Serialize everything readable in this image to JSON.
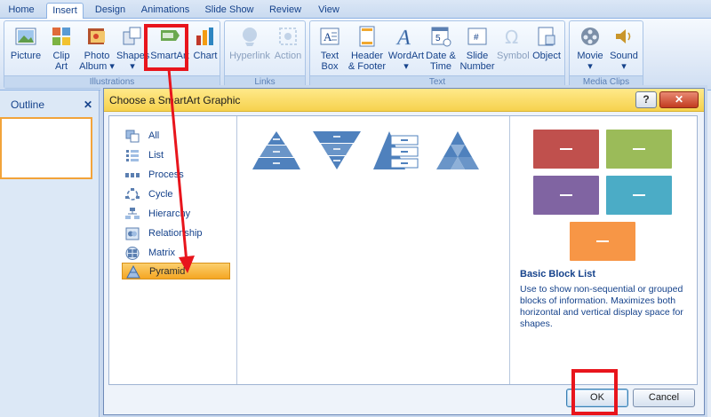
{
  "ribbon": {
    "tabs": [
      "Home",
      "Insert",
      "Design",
      "Animations",
      "Slide Show",
      "Review",
      "View"
    ],
    "active_tab": "Insert",
    "groups": {
      "illustrations": "Illustrations",
      "links": "Links",
      "text": "Text",
      "media": "Media Clips"
    },
    "buttons": {
      "picture": [
        "Picture"
      ],
      "clip_art": [
        "Clip",
        "Art"
      ],
      "photo_album": [
        "Photo",
        "Album ▾"
      ],
      "shapes": [
        "Shapes",
        "▾"
      ],
      "smartart": [
        "SmartArt"
      ],
      "chart": [
        "Chart"
      ],
      "hyperlink": [
        "Hyperlink"
      ],
      "action": [
        "Action"
      ],
      "text_box": [
        "Text",
        "Box"
      ],
      "header_footer": [
        "Header",
        "& Footer"
      ],
      "wordart": [
        "WordArt",
        "▾"
      ],
      "date_time": [
        "Date &",
        "Time"
      ],
      "slide_number": [
        "Slide",
        "Number"
      ],
      "symbol": [
        "Symbol"
      ],
      "object": [
        "Object"
      ],
      "movie": [
        "Movie",
        "▾"
      ],
      "sound": [
        "Sound",
        "▾"
      ]
    }
  },
  "pane": {
    "outline_tab": "Outline",
    "close_glyph": "✕"
  },
  "dialog": {
    "title": "Choose a SmartArt Graphic",
    "help_glyph": "?",
    "close_glyph": "✕",
    "categories": [
      {
        "label": "All",
        "icon": "all-icon"
      },
      {
        "label": "List",
        "icon": "list-icon"
      },
      {
        "label": "Process",
        "icon": "process-icon"
      },
      {
        "label": "Cycle",
        "icon": "cycle-icon"
      },
      {
        "label": "Hierarchy",
        "icon": "hierarchy-icon"
      },
      {
        "label": "Relationship",
        "icon": "relationship-icon"
      },
      {
        "label": "Matrix",
        "icon": "matrix-icon"
      },
      {
        "label": "Pyramid",
        "icon": "pyramid-icon"
      }
    ],
    "selected_category": "Pyramid",
    "preview": {
      "title": "Basic Block List",
      "description": "Use to show non-sequential or grouped blocks of information. Maximizes both horizontal and vertical display space for shapes.",
      "block_colors": [
        "#c0504d",
        "#9bbb59",
        "#8064a2",
        "#4bacc6",
        "#f79646"
      ]
    },
    "ok_label": "OK",
    "cancel_label": "Cancel"
  },
  "colors": {
    "accent_selected": "#f5a623",
    "annotation_red": "#e8151c",
    "title_bar": "#f6d24e"
  }
}
